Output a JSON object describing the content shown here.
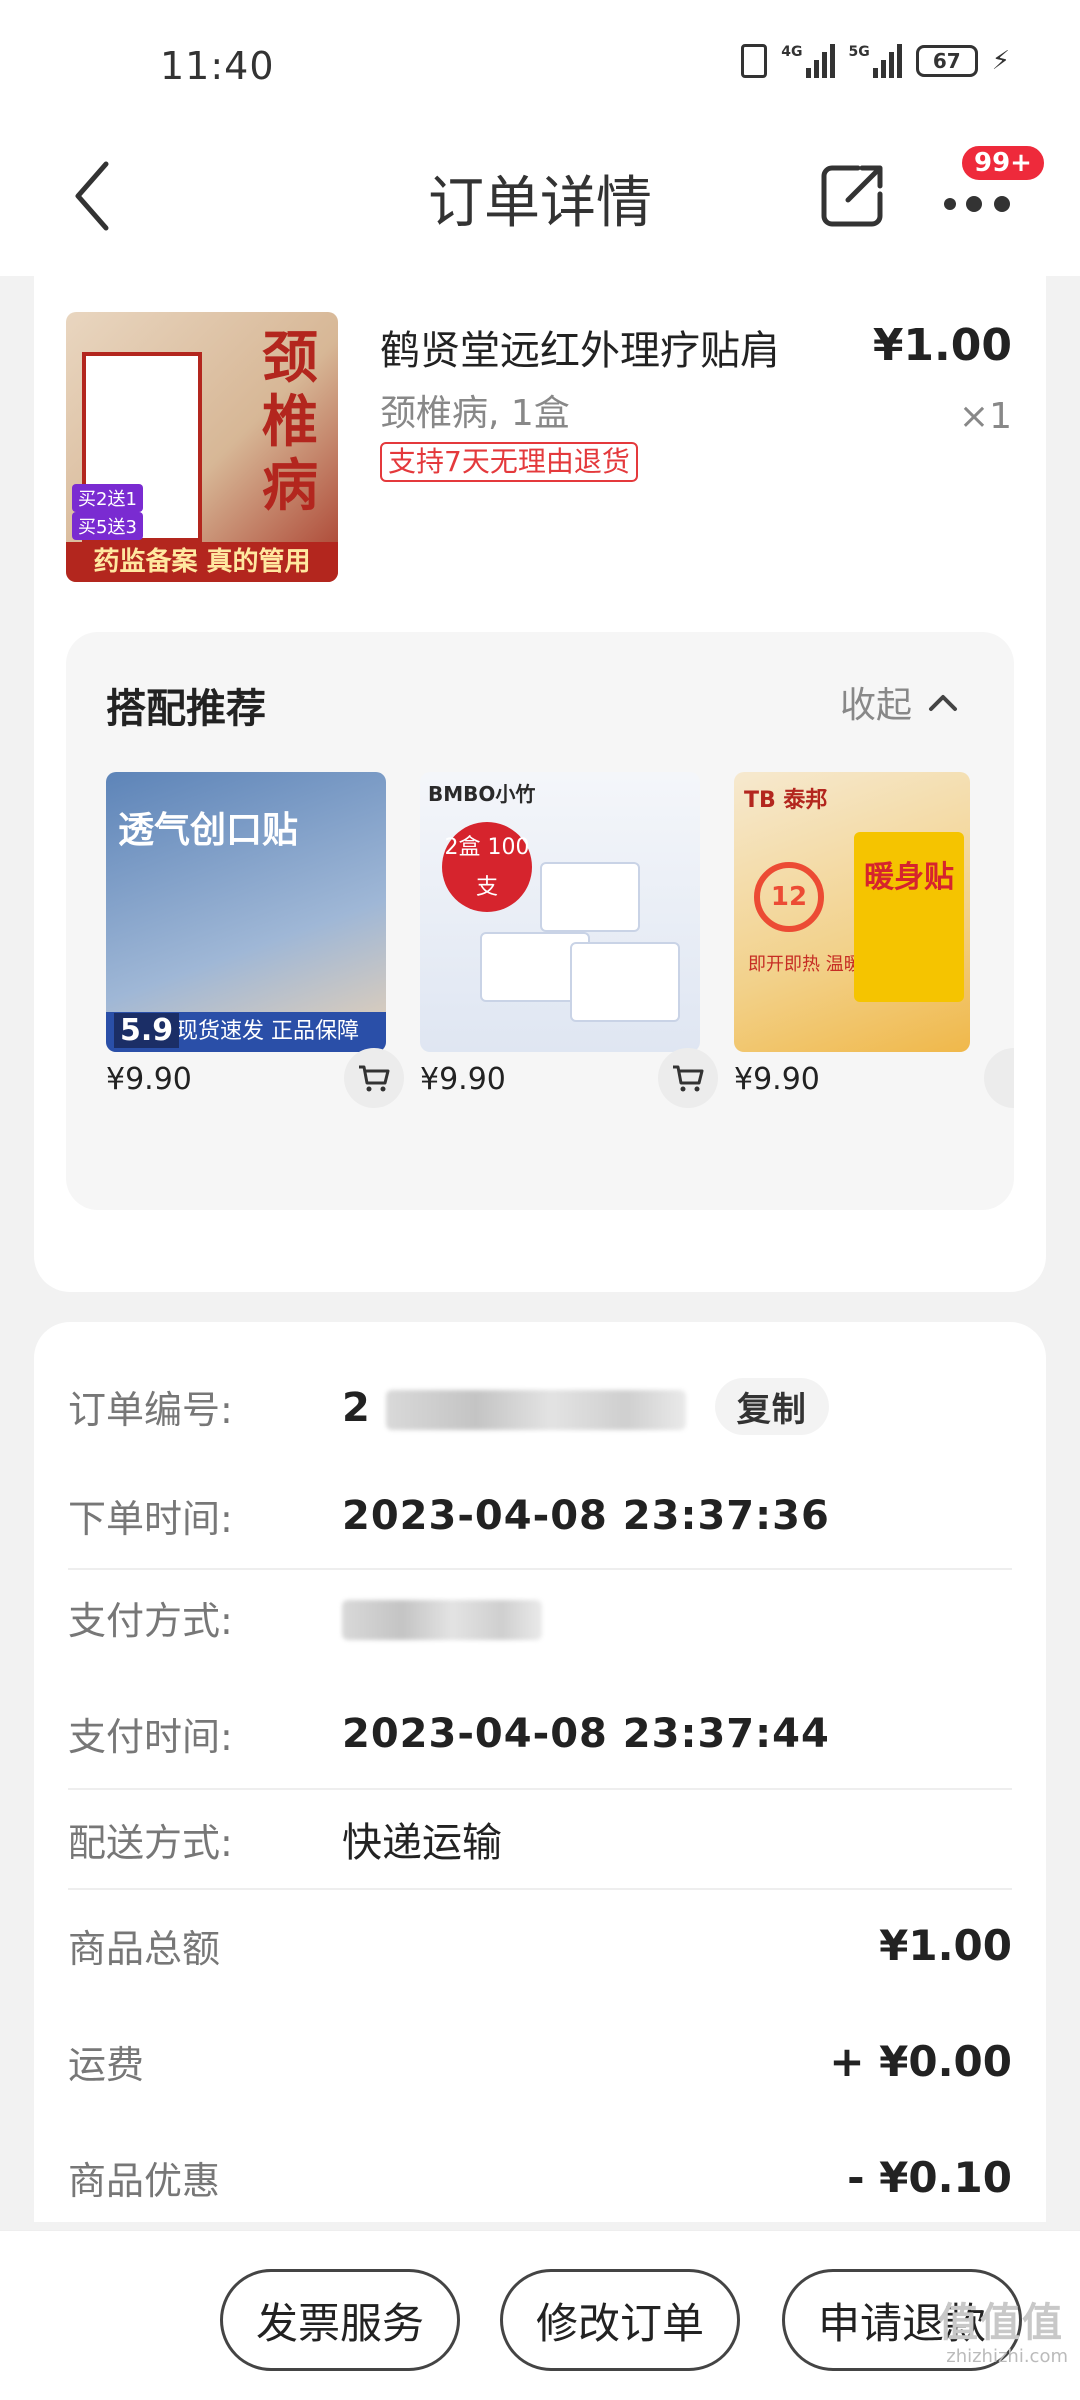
{
  "status_bar": {
    "time": "11:40",
    "net1": "4G",
    "net2": "5G",
    "battery": "67"
  },
  "header": {
    "title": "订单详情",
    "badge": "99+"
  },
  "product": {
    "name": "鹤贤堂远红外理疗贴肩",
    "spec": "颈椎病, 1盒",
    "tag": "支持7天无理由退货",
    "price": "¥1.00",
    "qty": "×1",
    "image": {
      "vertical_text": "颈椎病",
      "banner": "药监备案 真的管用",
      "promo1": "买2送1",
      "promo2": "买5送3"
    }
  },
  "recommend": {
    "title": "搭配推荐",
    "collapse_label": "收起",
    "items": [
      {
        "price": "¥9.90",
        "img_title": "透气创口贴",
        "img_price": "5.9",
        "img_banner": "现货速发 正品保障"
      },
      {
        "price": "¥9.90",
        "img_brand": "BMBO小竹",
        "img_badge": "2盒 100支"
      },
      {
        "price": "¥9.90",
        "img_brand": "TB 泰邦",
        "img_title": "暖身贴",
        "img_desc": "即开即热 温暖相随",
        "img_number": "12"
      }
    ]
  },
  "order": {
    "order_no_label": "订单编号:",
    "order_no_prefix": "2",
    "copy_label": "复制",
    "created_label": "下单时间:",
    "created_value": "2023-04-08 23:37:36",
    "pay_method_label": "支付方式:",
    "pay_time_label": "支付时间:",
    "pay_time_value": "2023-04-08 23:37:44",
    "delivery_label": "配送方式:",
    "delivery_value": "快递运输",
    "subtotal_label": "商品总额",
    "subtotal_value": "¥1.00",
    "shipping_label": "运费",
    "shipping_value": "+ ¥0.00",
    "discount_label": "商品优惠",
    "discount_value": "- ¥0.10"
  },
  "actions": {
    "invoice": "发票服务",
    "modify": "修改订单",
    "refund": "申请退款"
  },
  "watermark": {
    "logo": "值值值",
    "url": "zhizhizhi.com"
  },
  "colors": {
    "accent_red": "#e4393c",
    "badge_red": "#ee2a3b",
    "bg": "#f2f2f2"
  }
}
